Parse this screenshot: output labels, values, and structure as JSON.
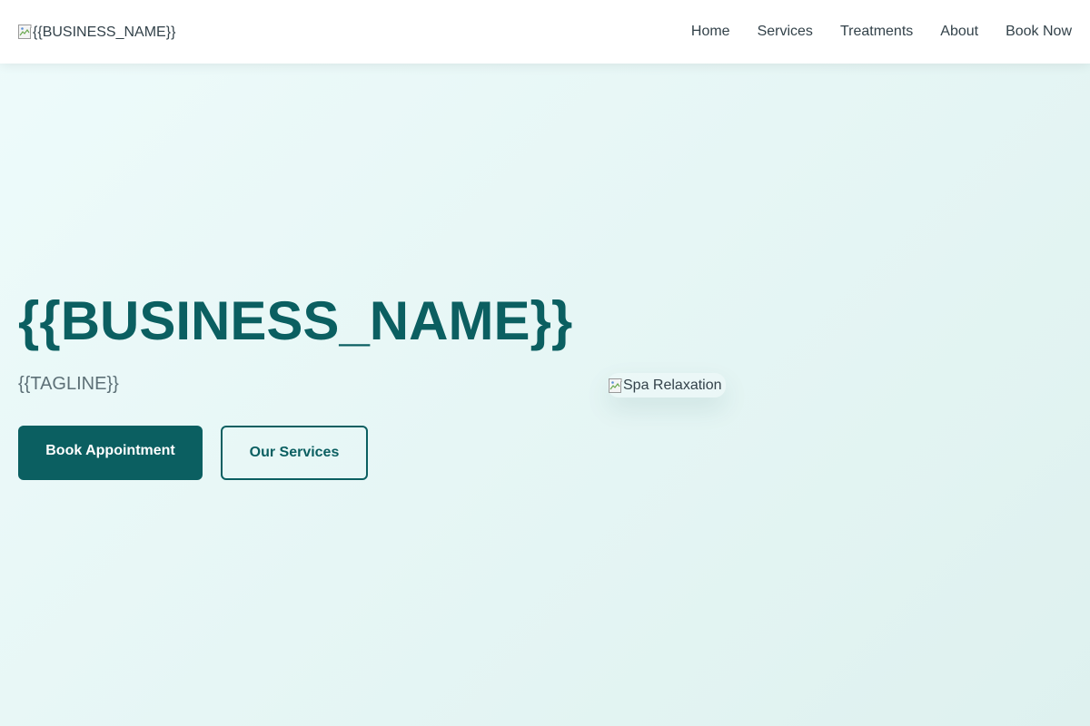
{
  "header": {
    "logo_alt": "{{BUSINESS_NAME}}",
    "logo_icon": "broken-image-icon",
    "nav": [
      {
        "label": "Home"
      },
      {
        "label": "Services"
      },
      {
        "label": "Treatments"
      },
      {
        "label": "About"
      },
      {
        "label": "Book Now"
      }
    ]
  },
  "hero": {
    "title": "{{BUSINESS_NAME}}",
    "tagline": "{{TAGLINE}}",
    "primary_button": "Book Appointment",
    "secondary_button": "Our Services",
    "image_alt": "Spa Relaxation",
    "image_icon": "broken-image-icon"
  },
  "colors": {
    "brand": "#0b5f61",
    "text": "#33424a",
    "muted": "#5d7077",
    "background": "#eaf8f7",
    "header_bg": "#ffffff"
  }
}
